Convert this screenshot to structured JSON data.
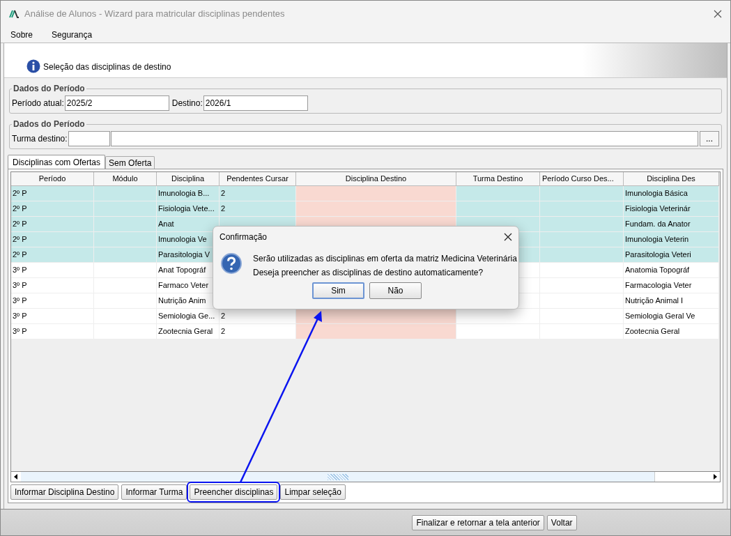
{
  "window": {
    "title": "Análise de Alunos - Wizard para matricular disciplinas pendentes"
  },
  "menu": [
    {
      "label": "Sobre"
    },
    {
      "label": "Segurança"
    }
  ],
  "header": {
    "text": "Seleção das disciplinas de destino"
  },
  "periodo": {
    "title": "Dados do Período",
    "fields": [
      {
        "label": "Período atual:",
        "value": "2025/2"
      },
      {
        "label": "Destino:",
        "value": "2026/1"
      }
    ]
  },
  "turma": {
    "title": "Dados do Período",
    "label": "Turma destino:",
    "browse": "..."
  },
  "tabs": [
    {
      "label": "Disciplinas com Ofertas",
      "selected": true
    },
    {
      "label": "Sem Oferta",
      "selected": false
    }
  ],
  "table": {
    "columns": [
      "Período",
      "Módulo",
      "Disciplina",
      "Pendentes Cursar",
      "Disciplina Destino",
      "Turma Destino",
      "Período Curso Des...",
      "Disciplina Des"
    ],
    "rows": [
      {
        "periodo": "2º P",
        "disciplina": "Imunologia B...",
        "pendentes": "2",
        "destino_original": "Imunologia Básica",
        "highlighted": true
      },
      {
        "periodo": "2º P",
        "disciplina": "Fisiologia Vete...",
        "pendentes": "2",
        "destino_original": "Fisiologia Veterinár",
        "highlighted": true
      },
      {
        "periodo": "2º P",
        "disciplina": "Anat",
        "destino_original": "Fundam. da Anator",
        "highlighted": true
      },
      {
        "periodo": "2º P",
        "disciplina": "Imunologia Ve",
        "destino_original": "Imunologia Veterin",
        "highlighted": true
      },
      {
        "periodo": "2º P",
        "disciplina": "Parasitologia V",
        "destino_original": "Parasitologia Veteri",
        "highlighted": true
      },
      {
        "periodo": "3º P",
        "disciplina": "Anat Topográf",
        "destino_original": "Anatomia Topográf",
        "highlighted": false
      },
      {
        "periodo": "3º P",
        "disciplina": "Farmaco Veter",
        "destino_original": "Farmacologia Veter",
        "highlighted": false
      },
      {
        "periodo": "3º P",
        "disciplina": "Nutrição Anim",
        "destino_original": "Nutrição Animal I",
        "highlighted": false
      },
      {
        "periodo": "3º P",
        "disciplina": "Semiologia Ge...",
        "pendentes": "2",
        "destino_original": "Semiologia Geral Ve",
        "highlighted": false
      },
      {
        "periodo": "3º P",
        "disciplina": "Zootecnia Geral",
        "pendentes": "2",
        "destino_original": "Zootecnia Geral",
        "highlighted": false
      }
    ]
  },
  "actions": [
    {
      "label": "Informar Disciplina Destino",
      "highlighted": false
    },
    {
      "label": "Informar Turma",
      "highlighted": false
    },
    {
      "label": "Preencher disciplinas",
      "highlighted": true
    },
    {
      "label": "Limpar seleção",
      "highlighted": false
    }
  ],
  "footer": {
    "buttons": [
      "Finalizar e retornar a tela anterior",
      "Voltar"
    ]
  },
  "dialog": {
    "title": "Confirmação",
    "lines": [
      "Serão utilizadas as disciplinas em oferta da matriz Medicina Veterinária",
      "Deseja preencher as disciplinas de destino automaticamente?"
    ],
    "buttons": [
      {
        "label": "Sim",
        "default": true
      },
      {
        "label": "Não",
        "default": false
      }
    ]
  }
}
